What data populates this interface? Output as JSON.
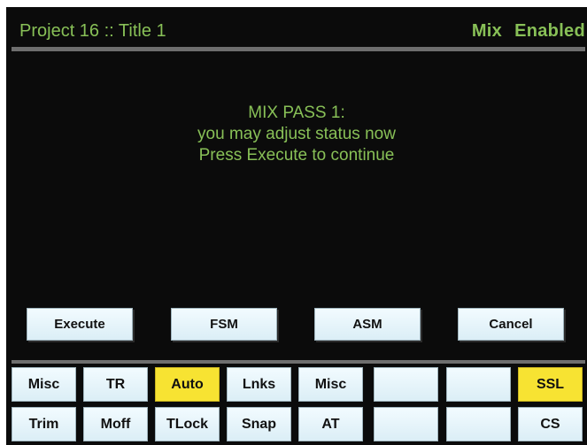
{
  "header": {
    "title": "Project 16  ::  Title 1",
    "status_mode": "Mix",
    "status_state": "Enabled"
  },
  "message": {
    "line1": "MIX PASS 1:",
    "line2": "you may adjust status now",
    "line3": "Press Execute to continue"
  },
  "actions": {
    "execute": "Execute",
    "fsm": "FSM",
    "asm": "ASM",
    "cancel": "Cancel"
  },
  "grid": {
    "row1": [
      "Misc",
      "TR",
      "Auto",
      "Lnks",
      "Misc",
      "",
      "",
      "SSL"
    ],
    "row2": [
      "Trim",
      "Moff",
      "TLock",
      "Snap",
      "AT",
      "",
      "",
      "CS"
    ],
    "highlighted": [
      "Auto",
      "SSL"
    ]
  },
  "colors": {
    "text_green": "#88c057",
    "screen_bg": "#0b0b0b",
    "button_bg": "#e6f4fa",
    "highlight": "#f7e332",
    "rule": "#6e6e6e"
  }
}
